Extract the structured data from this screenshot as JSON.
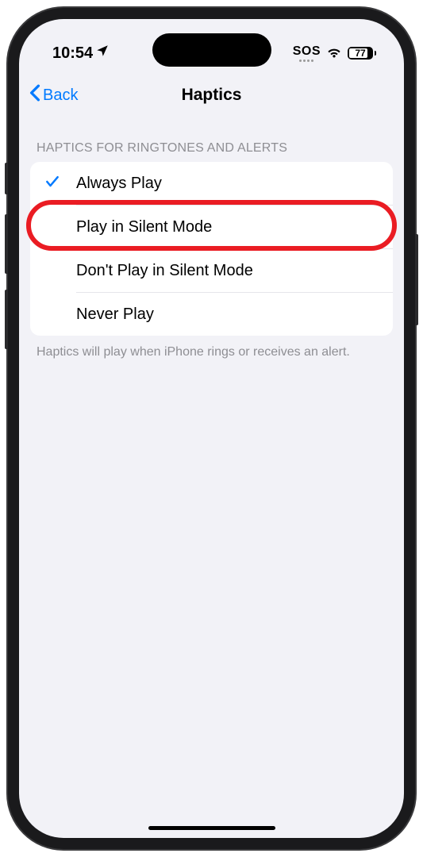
{
  "status_bar": {
    "time": "10:54",
    "sos": "SOS",
    "battery_percent": "77"
  },
  "nav": {
    "back_label": "Back",
    "title": "Haptics"
  },
  "section": {
    "header": "HAPTICS FOR RINGTONES AND ALERTS",
    "options": [
      {
        "label": "Always Play",
        "selected": true
      },
      {
        "label": "Play in Silent Mode",
        "selected": false
      },
      {
        "label": "Don't Play in Silent Mode",
        "selected": false
      },
      {
        "label": "Never Play",
        "selected": false
      }
    ],
    "footer": "Haptics will play when iPhone rings or receives an alert."
  },
  "highlighted_index": 1
}
